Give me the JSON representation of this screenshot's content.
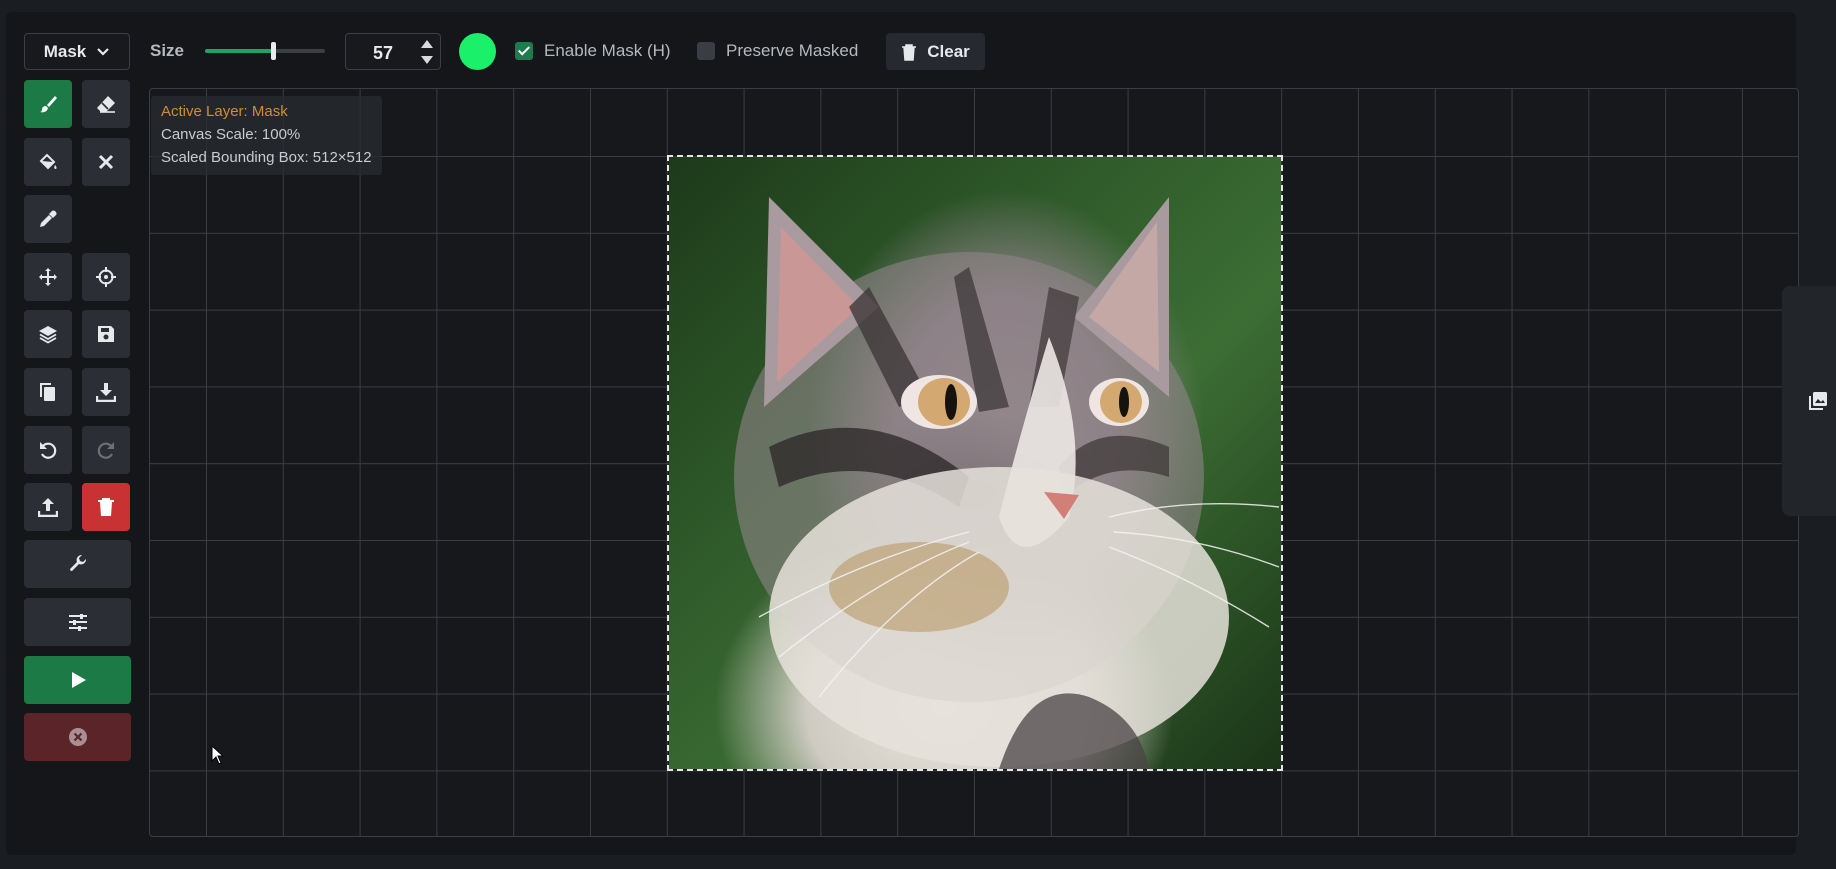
{
  "toolbar": {
    "layer_select": "Mask",
    "size_label": "Size",
    "size_value": "57",
    "size_fraction": 0.57,
    "brush_color": "#1bf06b",
    "enable_mask_label": "Enable Mask (H)",
    "enable_mask_checked": true,
    "preserve_masked_label": "Preserve Masked",
    "preserve_masked_checked": false,
    "clear_label": "Clear"
  },
  "tools": [
    {
      "name": "brush-tool",
      "icon": "brush-icon",
      "state": "active"
    },
    {
      "name": "eraser-tool",
      "icon": "eraser-icon"
    },
    {
      "name": "fill-bounding-box-tool",
      "icon": "paint-bucket-icon"
    },
    {
      "name": "erase-bounding-box-tool",
      "icon": "close-icon"
    },
    {
      "name": "color-picker-tool",
      "icon": "eyedropper-icon"
    },
    {
      "name": "move-tool",
      "icon": "move-icon"
    },
    {
      "name": "reset-view-tool",
      "icon": "crosshair-icon"
    },
    {
      "name": "merge-visible-tool",
      "icon": "layers-icon"
    },
    {
      "name": "save-to-gallery-tool",
      "icon": "save-icon"
    },
    {
      "name": "copy-to-clipboard-tool",
      "icon": "copy-icon"
    },
    {
      "name": "download-tool",
      "icon": "download-icon"
    },
    {
      "name": "undo-tool",
      "icon": "undo-icon"
    },
    {
      "name": "redo-tool",
      "icon": "redo-icon",
      "state": "disabled"
    },
    {
      "name": "upload-tool",
      "icon": "upload-icon"
    },
    {
      "name": "clear-canvas-tool",
      "icon": "trash-icon",
      "color": "#c93232"
    },
    {
      "name": "settings-tool",
      "icon": "wrench-icon"
    },
    {
      "name": "options-tool",
      "icon": "sliders-icon"
    },
    {
      "name": "invoke-button",
      "icon": "play-icon",
      "color": "#1b7a45"
    },
    {
      "name": "cancel-button",
      "icon": "cancel-circle-icon",
      "color": "#5a2428"
    }
  ],
  "canvas_info": {
    "active_layer": "Active Layer: Mask",
    "canvas_scale": "Canvas Scale: 100%",
    "bounding_box": "Scaled Bounding Box: 512×512"
  },
  "colors": {
    "accent_green": "#1b7a45",
    "active_layer_text": "#d18e2f",
    "danger": "#c93232"
  }
}
